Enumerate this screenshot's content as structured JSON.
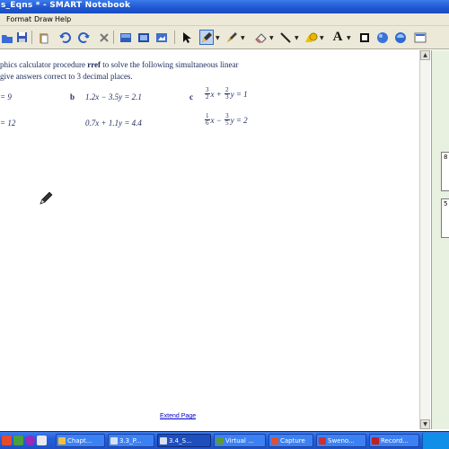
{
  "window": {
    "title": "s_Eqns * - SMART Notebook"
  },
  "menu": {
    "items": [
      "Format",
      "Draw",
      "Help"
    ]
  },
  "question": {
    "line1_pre": "phics calculator procedure ",
    "line1_bold": "rref",
    "line1_post": " to solve the following simultaneous linear",
    "line2": "give answers correct to 3 decimal places."
  },
  "parts": {
    "a": {
      "eq1": "= 9",
      "eq2": "= 12"
    },
    "b": {
      "label": "b",
      "eq1": "1.2x − 3.5y = 2.1",
      "eq2": "0.7x + 1.1y = 4.4"
    },
    "c": {
      "label": "c",
      "eq1": {
        "f1_num": "3",
        "f1_den": "2",
        "mid": "x +",
        "f2_num": "2",
        "f2_den": "3",
        "end": "y = 1"
      },
      "eq2": {
        "f1_num": "1",
        "f1_den": "6",
        "mid": "x −",
        "f2_num": "3",
        "f2_den": "5",
        "end": "y = 2"
      }
    }
  },
  "page": {
    "extend_link": "Extend Page"
  },
  "side_panel": {
    "thumb1": "8",
    "thumb2": "5"
  },
  "taskbar": {
    "tasks": [
      "Chapt...",
      "3.3_P...",
      "3.4_S...",
      "Virtual ...",
      "Capture",
      "Sweno...",
      "Record..."
    ]
  },
  "colors": {
    "title_bar": "#1e56d0",
    "toolbar": "#ece9d8",
    "taskbar": "#245edb",
    "text": "#1a2a5a",
    "link": "#0000cc"
  }
}
